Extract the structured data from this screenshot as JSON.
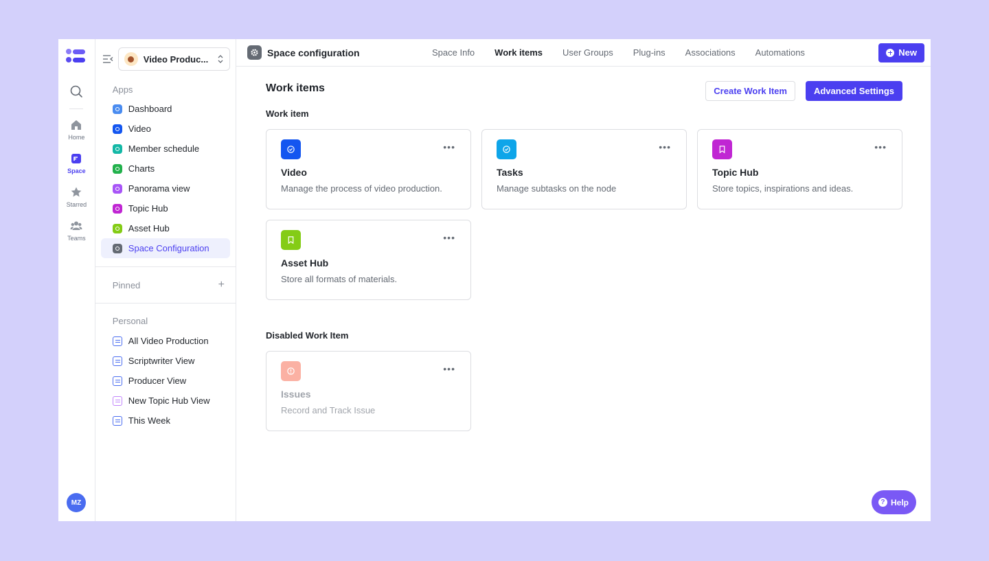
{
  "rail": {
    "items": [
      {
        "label": "Home"
      },
      {
        "label": "Space"
      },
      {
        "label": "Starred"
      },
      {
        "label": "Teams"
      }
    ],
    "avatar": "MZ"
  },
  "sidebar": {
    "space_name": "Video Produc...",
    "apps_title": "Apps",
    "apps": [
      {
        "label": "Dashboard",
        "color": "#4a8cf0"
      },
      {
        "label": "Video",
        "color": "#1456f0"
      },
      {
        "label": "Member schedule",
        "color": "#14b8a6"
      },
      {
        "label": "Charts",
        "color": "#22b14c"
      },
      {
        "label": "Panorama view",
        "color": "#a855f7"
      },
      {
        "label": "Topic Hub",
        "color": "#c026d3"
      },
      {
        "label": "Asset Hub",
        "color": "#84cc16"
      },
      {
        "label": "Space Configuration",
        "color": "#646a73"
      }
    ],
    "pinned_title": "Pinned",
    "personal_title": "Personal",
    "personal": [
      {
        "label": "All Video Production",
        "color": "#4a6cf0"
      },
      {
        "label": "Scriptwriter View",
        "color": "#4a6cf0"
      },
      {
        "label": "Producer View",
        "color": "#4a6cf0"
      },
      {
        "label": "New Topic Hub View",
        "color": "#c084fc"
      },
      {
        "label": "This Week",
        "color": "#4a6cf0"
      }
    ]
  },
  "header": {
    "title": "Space configuration",
    "tabs": [
      {
        "label": "Space Info"
      },
      {
        "label": "Work items"
      },
      {
        "label": "User Groups"
      },
      {
        "label": "Plug-ins"
      },
      {
        "label": "Associations"
      },
      {
        "label": "Automations"
      }
    ],
    "new_label": "New"
  },
  "content": {
    "title": "Work items",
    "create_label": "Create Work Item",
    "advanced_label": "Advanced Settings",
    "work_item_label": "Work item",
    "cards": [
      {
        "title": "Video",
        "desc": "Manage the process of video production.",
        "color": "#1456f0",
        "icon": "check-circle-icon"
      },
      {
        "title": "Tasks",
        "desc": "Manage subtasks on the node",
        "color": "#0ea5e9",
        "icon": "check-circle-icon"
      },
      {
        "title": "Topic Hub",
        "desc": "Store topics, inspirations and ideas.",
        "color": "#c026d3",
        "icon": "bookmark-icon"
      },
      {
        "title": "Asset Hub",
        "desc": "Store all formats of materials.",
        "color": "#84cc16",
        "icon": "bookmark-icon"
      }
    ],
    "disabled_label": "Disabled Work Item",
    "disabled_cards": [
      {
        "title": "Issues",
        "desc": "Record and Track Issue",
        "color": "#f87358",
        "icon": "alert-circle-icon"
      }
    ]
  },
  "help_label": "Help"
}
